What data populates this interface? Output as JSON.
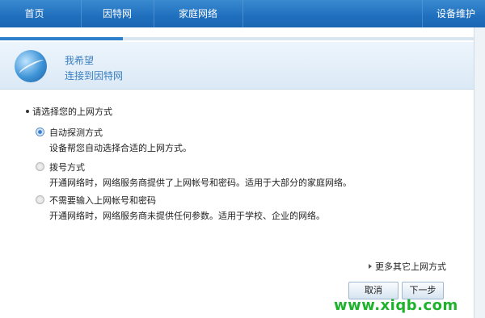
{
  "nav": {
    "items": [
      {
        "label": "首页"
      },
      {
        "label": "因特网"
      },
      {
        "label": "家庭网络"
      },
      {
        "label": "设备维护"
      }
    ]
  },
  "progress": {
    "fraction": 0.26
  },
  "banner": {
    "icon": "globe-icon",
    "title": "我希望",
    "subtitle": "连接到因特网"
  },
  "section": {
    "label": "请选择您的上网方式"
  },
  "options": [
    {
      "title": "自动探测方式",
      "desc": "设备帮您自动选择合适的上网方式。",
      "selected": true
    },
    {
      "title": "拨号方式",
      "desc": "开通网络时，网络服务商提供了上网帐号和密码。适用于大部分的家庭网络。",
      "selected": false
    },
    {
      "title": "不需要输入上网帐号和密码",
      "desc": "开通网络时，网络服务商未提供任何参数。适用于学校、企业的网络。",
      "selected": false
    }
  ],
  "more_link": "更多其它上网方式",
  "buttons": {
    "cancel": "取消",
    "next": "下一步"
  },
  "watermark": "www.xiqb.com",
  "colors": {
    "nav_bg": "#1f6fbe",
    "accent": "#3b7fc0",
    "watermark": "#1cb32b"
  }
}
